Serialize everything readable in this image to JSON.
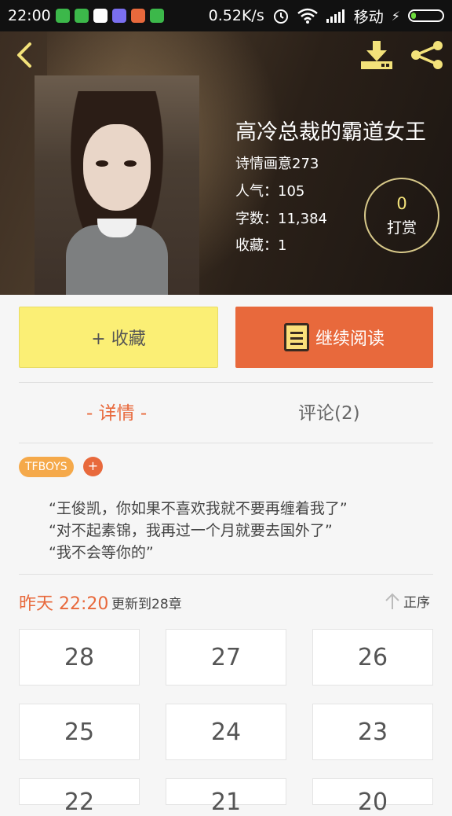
{
  "status_bar": {
    "time": "22:00",
    "net_speed": "0.52K/s",
    "carrier": "移动",
    "icons": [
      "alarm-icon",
      "wifi-icon",
      "signal-icon",
      "battery-icon"
    ]
  },
  "header": {
    "back_icon": "chevron-left-icon",
    "download_icon": "download-icon",
    "share_icon": "share-icon",
    "title": "高冷总裁的霸道女王",
    "author": "诗情画意273",
    "popularity": "人气：105",
    "word_count": "字数：11,384",
    "favorites": "收藏：1",
    "tip": {
      "count": "0",
      "label": "打赏"
    }
  },
  "actions": {
    "collect_label": "+ 收藏",
    "read_label": "继续阅读"
  },
  "tabs": [
    {
      "label": "- 详情 -",
      "active": true
    },
    {
      "label": "评论(2)",
      "active": false
    }
  ],
  "tags": [
    "TFBOYS"
  ],
  "tag_add": "+",
  "synopsis": [
    "“王俊凯，你如果不喜欢我就不要再缠着我了”",
    "“对不起素锦，我再过一个月就要去国外了”",
    "“我不会等你的”"
  ],
  "update": {
    "time": "昨天 22:20",
    "text": "更新到28章",
    "sort_label": "正序"
  },
  "chapters": [
    "28",
    "27",
    "26",
    "25",
    "24",
    "23",
    "22",
    "21",
    "20"
  ],
  "colors": {
    "accent": "#e8693c",
    "collect_bg": "#fbef75",
    "tip_number": "#f3e27a"
  }
}
